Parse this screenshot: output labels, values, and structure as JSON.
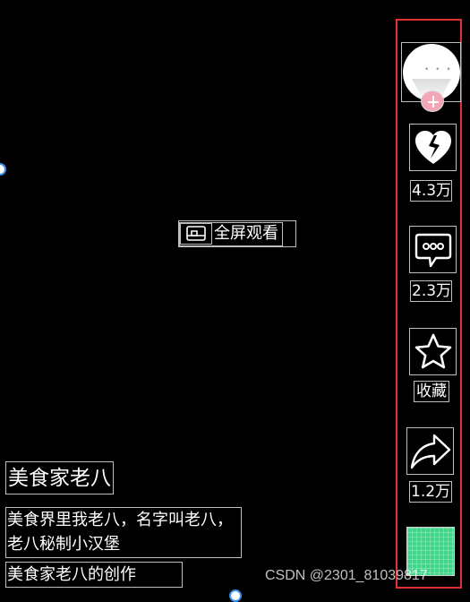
{
  "center": {
    "fullscreen_label": "全屏观看"
  },
  "actions": {
    "like_count": "4.3万",
    "comment_count": "2.3万",
    "favorite_label": "收藏",
    "share_count": "1.2万"
  },
  "post": {
    "author_name": "美食家老八",
    "description": "美食界里我老八，名字叫老八，老八秘制小汉堡",
    "creation_label": "美食家老八的创作"
  },
  "watermark": "CSDN @2301_81039817",
  "icons": {
    "fullscreen": "fullscreen-icon",
    "like": "broken-heart-icon",
    "comment": "comment-bubble-icon",
    "favorite": "star-icon",
    "share": "share-arrow-icon"
  },
  "colors": {
    "background": "#000000",
    "rail_outline": "#e03030",
    "follow_badge": "#f5a6b6",
    "music_thumb": "#3fd68a",
    "edge_dot": "#3b8ee8"
  }
}
